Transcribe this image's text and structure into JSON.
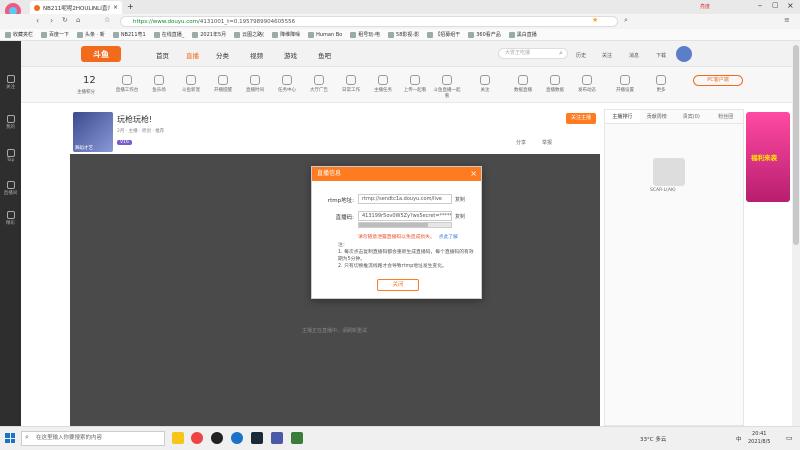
{
  "browser": {
    "logo_label": "云帆频道",
    "tab_title": "NB211呢呢2HOULINLI直介",
    "url_prefix": "https://",
    "url_host": "www.douyu.com",
    "url_path": "/4131001_t=0.1957989904605556",
    "right_badge": "亮度"
  },
  "bookmarks": [
    "收藏夹栏",
    "百度一下",
    "头条 · 新",
    "NB211粤1",
    "在线直播_",
    "2021年5月",
    "云图之路(",
    "降维降噪",
    "Human Bo",
    "租号玩-电",
    "58影视-影",
    "【招募组干",
    "360看产品",
    "黑白直播"
  ],
  "leftbar": [
    "关注",
    "我的",
    "Top",
    "直播间",
    "精彩"
  ],
  "site": {
    "logo": "斗鱼",
    "nav": [
      "首页",
      "直播",
      "分类",
      "视频",
      "游戏",
      "鱼吧"
    ],
    "active_nav": "直播",
    "search_placeholder": "大胃王吃播",
    "user_icons": [
      "历史",
      "关注",
      "消息",
      "下载"
    ],
    "pc_client": "PC客户端"
  },
  "toolbar": {
    "count": "12",
    "count_label": "主播积分",
    "items": [
      "直播工作台",
      "鱼乐场",
      "斗鱼新宠",
      "开播提醒",
      "直播时间",
      "任务中心",
      "大厅广告",
      "日常工作",
      "主播任务",
      "上传一起看",
      "斗鱼直播一起看",
      "关注",
      "数据直播",
      "直播数据",
      "发布动态",
      "开播设置",
      "更多"
    ]
  },
  "stream": {
    "title": "玩枪玩枪!",
    "avatar_label": "舞蹈才艺",
    "meta": "2月 · 主播 · 原创 · 推荐",
    "level": "V16",
    "follow_label": "关注主播",
    "share_label": "分享",
    "report_label": "举报"
  },
  "rightpanel": {
    "tabs": [
      "主播排行",
      "贡献周榜",
      "贵宾(0)",
      "粉丝团"
    ],
    "ad_label": "福利来袭",
    "ad_text": "SCAR-L(AK)"
  },
  "player": {
    "message": "主播正在直播中，请刷新重试"
  },
  "modal": {
    "title": "直播信息",
    "close": "×",
    "rtmp_label": "rtmp地址:",
    "rtmp_value": "rtmp://sendtc1a.douyu.com/live",
    "copy_label": "复制",
    "code_label": "直播码:",
    "code_value": "413199r5ov0W5Zy?ws5ecret=*******",
    "progress_percent": 75,
    "warning": "请勿随意泄露直播码以免造成损失。",
    "warning_link": "点此了解",
    "notes_title": "注：",
    "note1": "1. 每次点击复制直播码都会重新生成直播码，每个直播码的有效期为5分钟。",
    "note2": "2. 只有切换推流线路才会导致rtmp地址发生变化。",
    "confirm": "关闭"
  },
  "taskbar": {
    "search_placeholder": "在这里输入你要搜索的内容",
    "weather": "33°C 多云",
    "lang": "中",
    "time": "20:41",
    "date": "2021/8/5"
  },
  "colors": {
    "accent": "#ff7b1f",
    "douyu_orange": "#f26b1d",
    "player_bg": "#4a4a4a"
  }
}
